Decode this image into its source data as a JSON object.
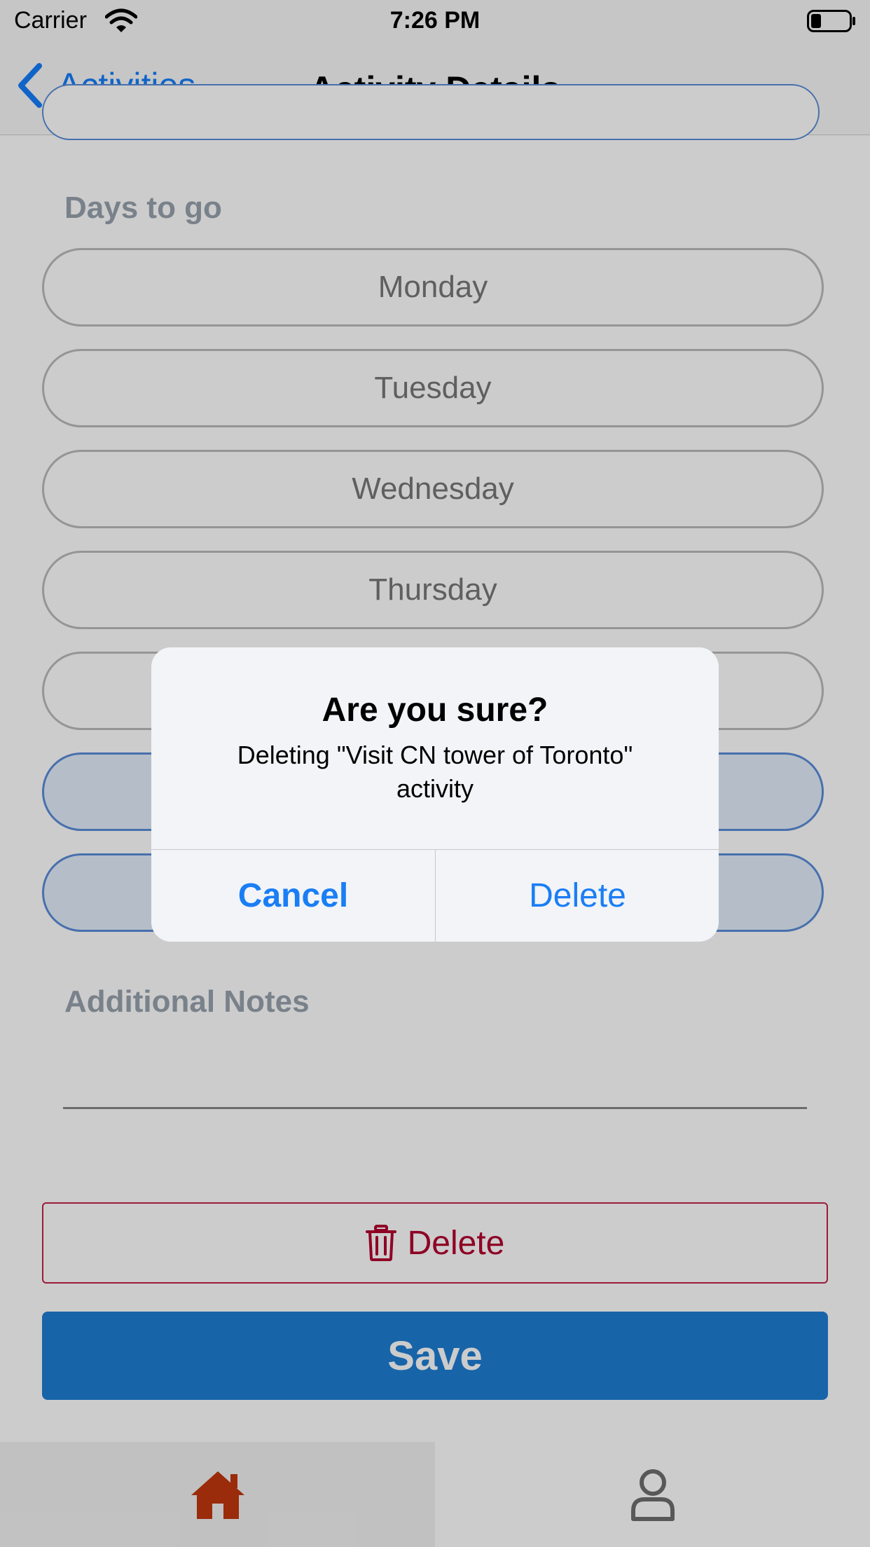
{
  "status_bar": {
    "carrier": "Carrier",
    "time": "7:26 PM"
  },
  "nav": {
    "back_label": "Activities",
    "title": "Activity Details"
  },
  "content": {
    "days_label": "Days to go",
    "days": [
      {
        "label": "Monday",
        "selected": false
      },
      {
        "label": "Tuesday",
        "selected": false
      },
      {
        "label": "Wednesday",
        "selected": false
      },
      {
        "label": "Thursday",
        "selected": false
      },
      {
        "label": "",
        "selected": false
      },
      {
        "label": "",
        "selected": true
      },
      {
        "label": "",
        "selected": true
      }
    ],
    "notes_label": "Additional Notes",
    "notes_value": "",
    "delete_label": "Delete",
    "save_label": "Save"
  },
  "tab_bar": {
    "home_icon": "home-icon",
    "profile_icon": "person-icon",
    "active_color": "#c1360e",
    "inactive_color": "#6f6f6f"
  },
  "alert": {
    "title": "Are you sure?",
    "message": "Deleting \"Visit CN tower of Toronto\" activity",
    "cancel_label": "Cancel",
    "confirm_label": "Delete"
  },
  "colors": {
    "accent": "#147efb",
    "save_bg": "#1f7ed4",
    "delete": "#b3002d"
  }
}
